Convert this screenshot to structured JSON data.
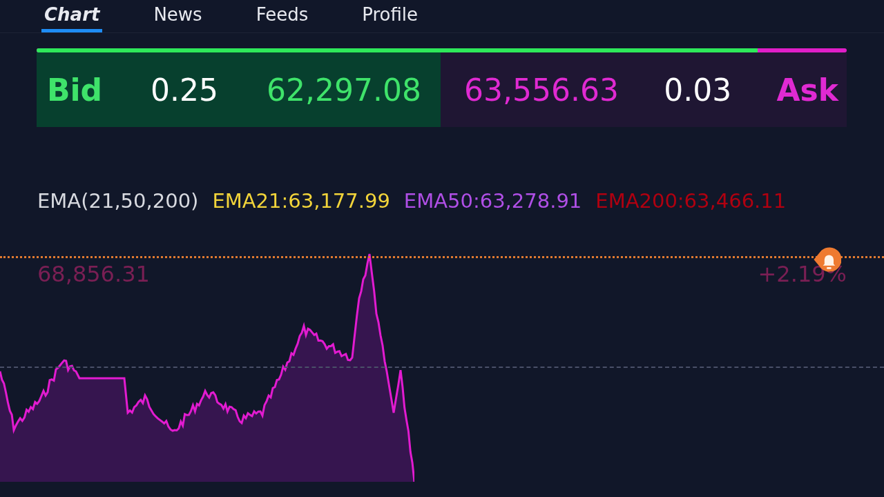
{
  "nav": {
    "tabs": [
      {
        "label": "Chart",
        "selected": true
      },
      {
        "label": "News",
        "selected": false
      },
      {
        "label": "Feeds",
        "selected": false
      },
      {
        "label": "Profile",
        "selected": false
      }
    ]
  },
  "order_book": {
    "bid_label": "Bid",
    "bid_size": "0.25",
    "bid_price": "62,297.08",
    "ask_price": "63,556.63",
    "ask_size": "0.03",
    "ask_label": "Ask",
    "level": 0.89
  },
  "indicators": {
    "label": "EMA(21,50,200)",
    "items": [
      {
        "text": "EMA21:63,177.99",
        "color": "#f2d43a"
      },
      {
        "text": "EMA50:63,278.91",
        "color": "#b04fe6"
      },
      {
        "text": "EMA200:63,466.11",
        "color": "#b00010"
      }
    ]
  },
  "chart": {
    "high_label": "68,856.31",
    "change_label": "+2.19%",
    "alert": true
  }
}
